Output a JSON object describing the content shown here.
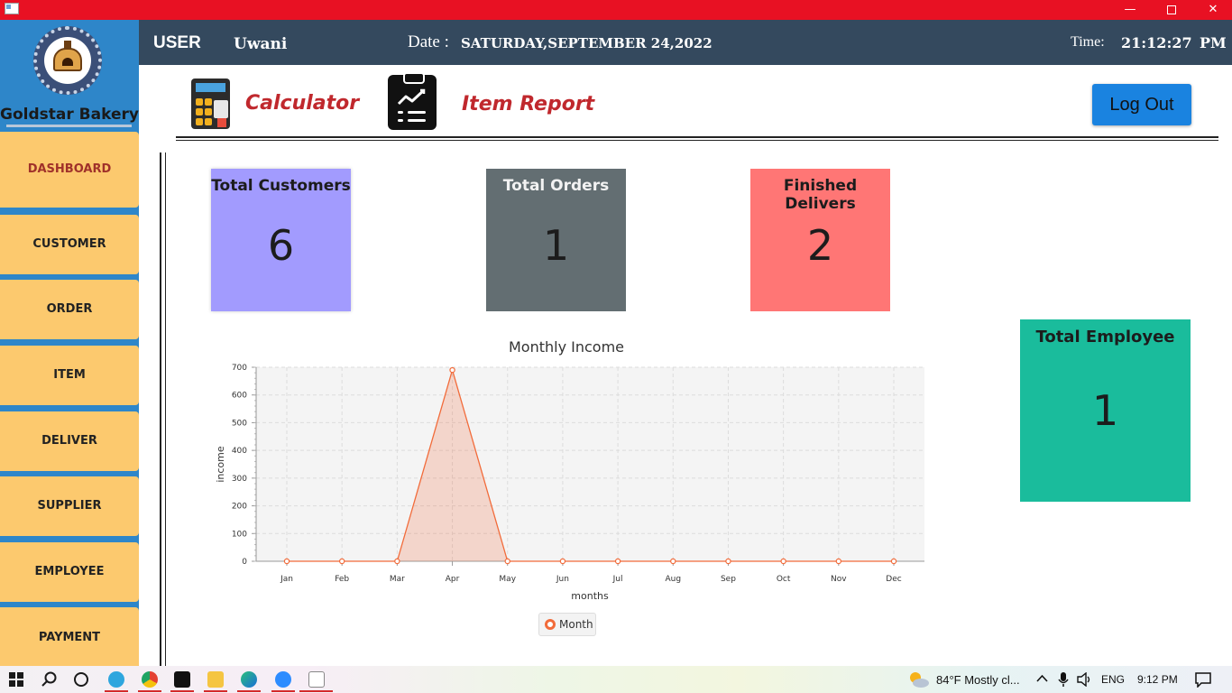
{
  "window": {
    "controls": {
      "minimize": "—",
      "close": "✕"
    }
  },
  "brand": {
    "name": "Goldstar Bakery"
  },
  "nav": {
    "items": [
      {
        "label": "DASHBOARD",
        "active": true
      },
      {
        "label": "CUSTOMER"
      },
      {
        "label": "ORDER"
      },
      {
        "label": "ITEM"
      },
      {
        "label": "DELIVER"
      },
      {
        "label": "SUPPLIER"
      },
      {
        "label": "EMPLOYEE"
      },
      {
        "label": "PAYMENT"
      }
    ]
  },
  "header": {
    "user_label": "USER",
    "user_name": "Uwani",
    "date_label": "Date :",
    "date_value": "SATURDAY,SEPTEMBER 24,2022",
    "time_label": "Time:",
    "time_value": "21:12:27",
    "ampm": "PM"
  },
  "toolbar": {
    "calculator_label": "Calculator",
    "calculator_icon": "calculator-icon",
    "report_label": "Item Report",
    "report_icon": "clipboard-chart-icon",
    "logout_label": "Log Out"
  },
  "stats": {
    "customers": {
      "title": "Total Customers",
      "value": "6",
      "color": "#a29bfe"
    },
    "orders": {
      "title": "Total Orders",
      "value": "1",
      "color": "#636e72"
    },
    "delivers": {
      "title": "Finished Delivers",
      "value": "2",
      "color": "#ff7675"
    },
    "employee": {
      "title": "Total Employee",
      "value": "1",
      "color": "#1abc9c"
    }
  },
  "chart_data": {
    "type": "area",
    "title": "Monthly Income",
    "xlabel": "months",
    "ylabel": "income",
    "categories": [
      "Jan",
      "Feb",
      "Mar",
      "Apr",
      "May",
      "Jun",
      "Jul",
      "Aug",
      "Sep",
      "Oct",
      "Nov",
      "Dec"
    ],
    "series": [
      {
        "name": "Month",
        "values": [
          0,
          0,
          0,
          690,
          0,
          0,
          0,
          0,
          0,
          0,
          0,
          0
        ],
        "color": "#f26b3a"
      }
    ],
    "ylim": [
      0,
      700
    ],
    "yticks": [
      0,
      100,
      200,
      300,
      400,
      500,
      600,
      700
    ],
    "grid": true,
    "legend": "bottom-center"
  },
  "taskbar": {
    "weather": "84°F  Mostly cl...",
    "lang": "ENG",
    "clock": "9:12 PM",
    "accent": "#d42a2a"
  }
}
